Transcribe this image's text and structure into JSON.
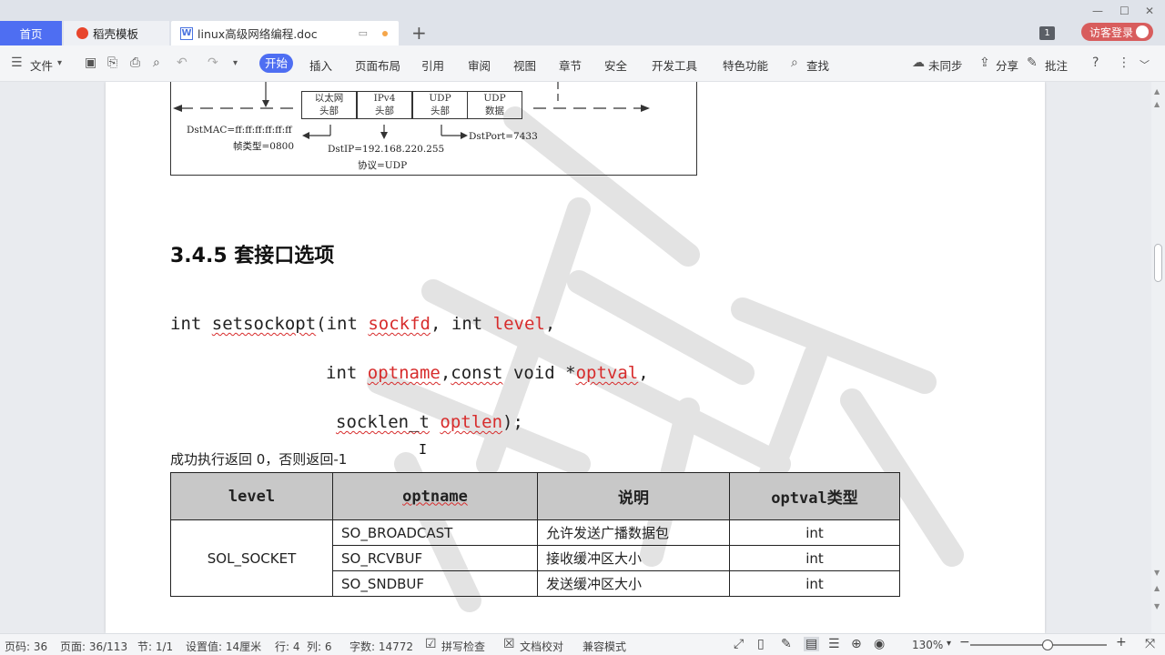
{
  "tabs": {
    "home": "首页",
    "docer": "稻壳模板",
    "doc": "linux高级网络编程.doc",
    "new_tab": "+"
  },
  "window": {
    "badge": "1",
    "login": "访客登录",
    "minimize": "—",
    "maximize": "☐",
    "close": "✕"
  },
  "menu": {
    "file": "文件",
    "items": [
      "开始",
      "插入",
      "页面布局",
      "引用",
      "审阅",
      "视图",
      "章节",
      "安全",
      "开发工具",
      "特色功能"
    ],
    "search": "查找",
    "sync": "未同步",
    "share": "分享",
    "annotate": "批注"
  },
  "diagram": {
    "boxes": [
      {
        "top": "以太网",
        "bottom": "头部"
      },
      {
        "top": "IPv4",
        "bottom": "头部"
      },
      {
        "top": "UDP",
        "bottom": "头部"
      },
      {
        "top": "UDP",
        "bottom": "数据"
      }
    ],
    "dst_mac": "DstMAC=ff:ff:ff:ff:ff:ff",
    "frame_type": "帧类型=0800",
    "dst_ip": "DstIP=192.168.220.255",
    "protocol": "协议=UDP",
    "dst_port": "DstPort=7433"
  },
  "heading": "3.4.5 套接口选项",
  "code": {
    "l1_a": "int ",
    "l1_fn": "setsockopt",
    "l1_b": "(int ",
    "l1_p1": "sockfd",
    "l1_c": ", int ",
    "l1_p2": "level",
    "l1_d": ",",
    "l2_a": "int ",
    "l2_p1": "optname",
    "l2_b": ",",
    "l2_kw": "const",
    "l2_c": " void *",
    "l2_p2": "optval",
    "l2_d": ",",
    "l3_type": "socklen_t",
    "l3_a": " ",
    "l3_p": "optlen",
    "l3_b": ");"
  },
  "return_text": "成功执行返回 0，否则返回-1",
  "table": {
    "headers": [
      "level",
      "optname",
      "说明",
      "optval类型"
    ],
    "level_value": "SOL_SOCKET",
    "rows": [
      {
        "optname": "SO_BROADCAST",
        "desc": "允许发送广播数据包",
        "type": "int"
      },
      {
        "optname": "SO_RCVBUF",
        "desc": "接收缓冲区大小",
        "type": "int"
      },
      {
        "optname": "SO_SNDBUF",
        "desc": "发送缓冲区大小",
        "type": "int"
      }
    ]
  },
  "status": {
    "page_code": "页码: 36",
    "page": "页面: 36/113",
    "section": "节: 1/1",
    "setting": "设置值: 14厘米",
    "row": "行: 4",
    "col": "列: 6",
    "word_count": "字数: 14772",
    "spell_check": "拼写检查",
    "proofread": "文档校对",
    "compat": "兼容模式",
    "zoom": "130%"
  }
}
